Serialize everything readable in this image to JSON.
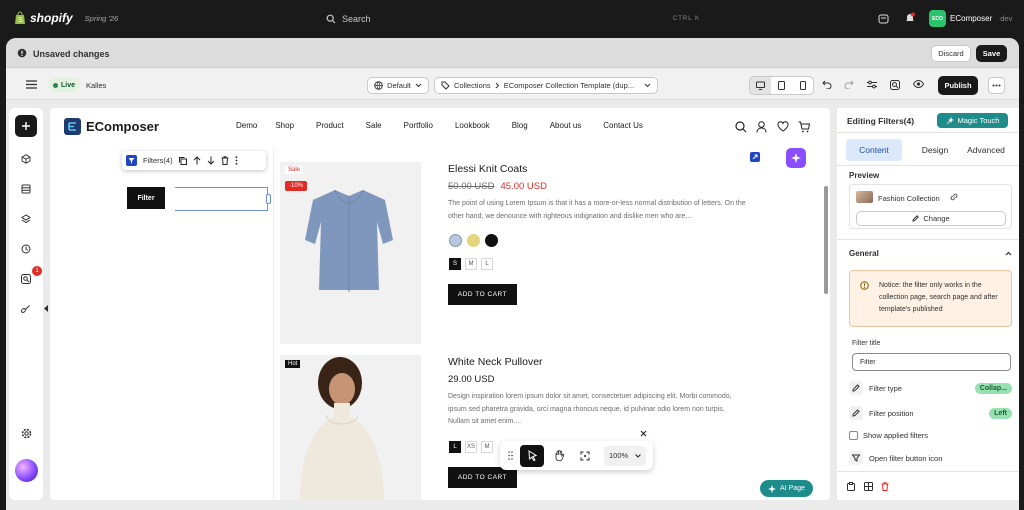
{
  "topbar": {
    "brand": "shopify",
    "edition": "Spring '26",
    "search_placeholder": "Search",
    "shortcut": "CTRL  K",
    "app_badge": "ECO",
    "app_name": "EComposer",
    "app_env": "dev",
    "notification_count": ""
  },
  "unsaved": {
    "title": "Unsaved changes",
    "discard": "Discard",
    "save": "Save"
  },
  "toolbar": {
    "live": "Live",
    "theme": "Kalles",
    "layout": "Default",
    "breadcrumb_root": "Collections",
    "breadcrumb_page": "EComposer Collection Template (dup...",
    "publish": "Publish"
  },
  "leftbar": {
    "notification_count": "1"
  },
  "store": {
    "logo": "EComposer",
    "nav": [
      "Demo",
      "Shop",
      "Product",
      "Sale",
      "Portfolio",
      "Lookbook",
      "Blog",
      "About us",
      "Contact Us"
    ]
  },
  "element_toolbar": {
    "label": "Filters(4)"
  },
  "filter_button": "Filter",
  "products": [
    {
      "title": "Elessi Knit Coats",
      "old_price": "50.00 USD",
      "price": "45.00 USD",
      "badge": "Sale",
      "discount": "-10%",
      "desc": "The point of using Lorem Ipsum is that it has a more-or-less normal distribution of letters. On the other hand, we denounce with righteous indignation and dislike men who are...",
      "sizes": [
        "S",
        "M",
        "L"
      ],
      "cta": "ADD TO CART"
    },
    {
      "title": "White Neck Pullover",
      "price": "29.00 USD",
      "badge": "Hot",
      "desc": "Design inspiration lorem ipsum dolor sit amet, consectetuer adipiscing elit. Morbi commodo, ipsum sed pharetra gravida, orci magna rhoncus neque, id pulvinar odio lorem non turpis. Nullam sit amet enim....",
      "sizes": [
        "L",
        "XS",
        "M"
      ],
      "cta": "ADD TO CART"
    }
  ],
  "bottom_toolbar": {
    "zoom": "100%"
  },
  "ai_page": "AI Page",
  "panel": {
    "title": "Editing Filters(4)",
    "magic": "Magic Touch",
    "tabs": [
      "Content",
      "Design",
      "Advanced"
    ],
    "preview_label": "Preview",
    "collection": "Fashion Collection",
    "change": "Change",
    "general": "General",
    "notice": "Notice: the filter only works in the collection page, search page and after template's published",
    "filter_title_label": "Filter title",
    "filter_title_value": "Filter",
    "filter_type_label": "Filter type",
    "filter_type_value": "Collap...",
    "filter_position_label": "Filter position",
    "filter_position_value": "Left",
    "show_applied": "Show applied filters",
    "open_icon": "Open filter button icon"
  },
  "colors": {
    "accent_green": "#29845a",
    "sale_red": "#e02b27",
    "magic": "#1f8c8c",
    "purple": "#8a4dff"
  }
}
